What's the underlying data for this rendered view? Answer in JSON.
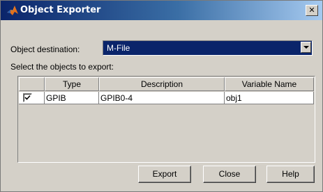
{
  "window": {
    "title": "Object Exporter",
    "close_glyph": "✕"
  },
  "destination": {
    "label": "Object destination:",
    "selected": "M-File"
  },
  "objects": {
    "label": "Select the objects to export:",
    "columns": [
      "Type",
      "Description",
      "Variable Name"
    ],
    "rows": [
      {
        "checked": true,
        "type": "GPIB",
        "description": "GPIB0-4",
        "variable_name": "obj1"
      }
    ]
  },
  "buttons": {
    "export": "Export",
    "close": "Close",
    "help": "Help"
  },
  "colors": {
    "titlebar_start": "#0a246a",
    "titlebar_end": "#a6caf0",
    "face": "#d4d0c8",
    "selection": "#0a246a"
  },
  "icons": {
    "app": "matlab-membrane-icon",
    "dropdown": "chevron-down-icon",
    "check": "check-icon"
  }
}
